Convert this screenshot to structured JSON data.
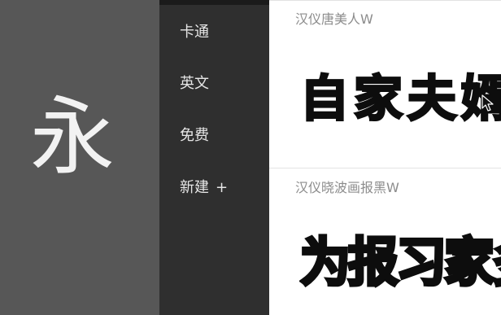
{
  "preview": {
    "glyph": "永"
  },
  "menu": {
    "items": [
      {
        "label": "卡通"
      },
      {
        "label": "英文"
      },
      {
        "label": "免费"
      },
      {
        "label": "新建",
        "suffix": "+"
      }
    ]
  },
  "fonts": [
    {
      "name": "汉仪唐美人W",
      "sample": "自家夫婿"
    },
    {
      "name": "汉仪晓波画报黑W",
      "sample": "为报习家多"
    }
  ],
  "colors": {
    "preview_bg": "#575757",
    "menu_bg": "#2f2f2f",
    "list_bg": "#ffffff",
    "font_name_text": "#8c8c8c"
  }
}
